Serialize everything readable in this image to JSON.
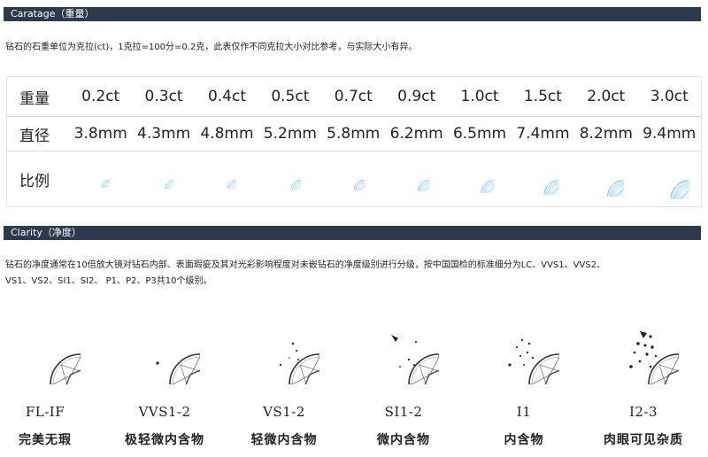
{
  "carat_section": {
    "title": "Caratage（重量）",
    "note": "钻石的石重单位为克拉(ct)，1克拉=100分=0.2克，此表仅作不同克拉大小对比参考，与实际大小有异。",
    "row_weight_label": "重量",
    "row_diameter_label": "直径",
    "row_ratio_label": "比例",
    "weights": [
      "0.2ct",
      "0.3ct",
      "0.4ct",
      "0.5ct",
      "0.7ct",
      "0.9ct",
      "1.0ct",
      "1.5ct",
      "2.0ct",
      "3.0ct"
    ],
    "diameters": [
      "3.8mm",
      "4.3mm",
      "4.8mm",
      "5.2mm",
      "5.8mm",
      "6.2mm",
      "6.5mm",
      "7.4mm",
      "8.2mm",
      "9.4mm"
    ],
    "gem_color": "#8fc8e8"
  },
  "clarity_section": {
    "title": "Clarity（净度）",
    "note_line1": "钻石的净度通常在10倍放大镜对钻石内部、表面瑕疵及其对光彩影响程度对未嵌钻石的净度级别进行分级，按中国国检的标准细分为LC、VVS1、VVS2、",
    "note_line2": "VS1、VS2、SI1、SI2、 P1、P2、P3共10个级别。",
    "grades": [
      {
        "grade": "FL-IF",
        "desc": "完美无瑕"
      },
      {
        "grade": "VVS1-2",
        "desc": "极轻微内含物"
      },
      {
        "grade": "VS1-2",
        "desc": "轻微内含物"
      },
      {
        "grade": "SI1-2",
        "desc": "微内含物"
      },
      {
        "grade": "I1",
        "desc": "内含物"
      },
      {
        "grade": "I2-3",
        "desc": "肉眼可见杂质"
      }
    ]
  },
  "colors": {
    "bar": "#2c3a4d",
    "bar_text": "#ffffff"
  }
}
